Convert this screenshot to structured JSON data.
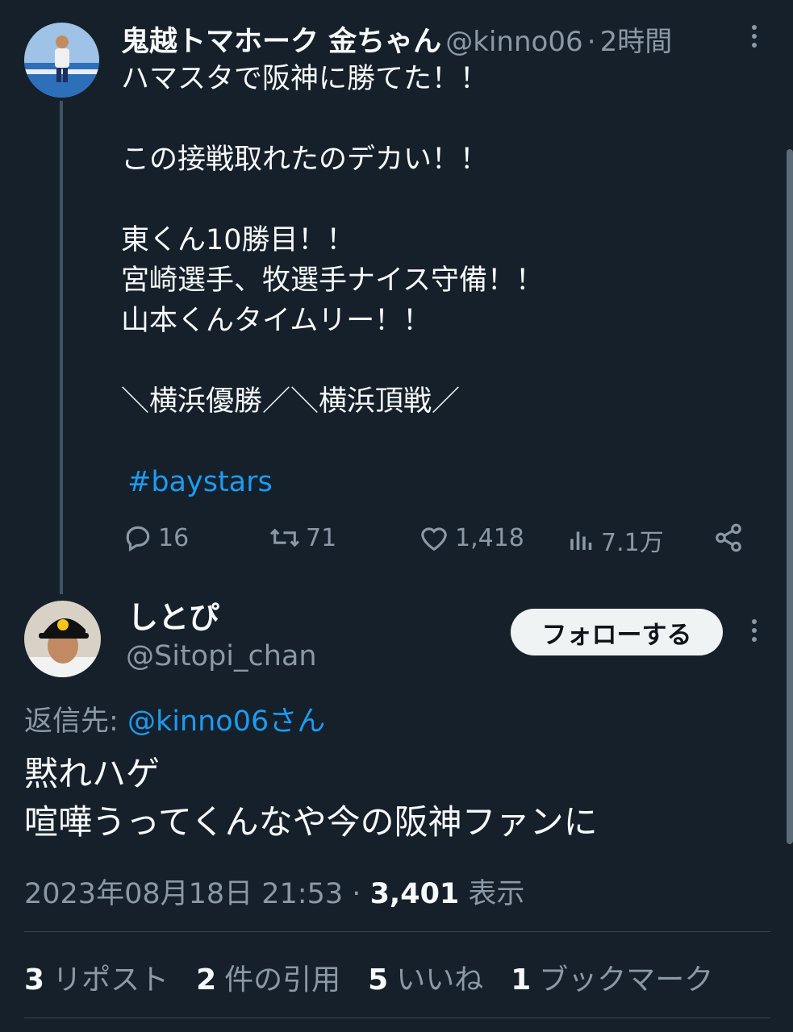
{
  "parent_tweet": {
    "display_name": "鬼越トマホーク 金ちゃん",
    "handle": "@kinno06",
    "separator": "·",
    "time_ago": "2時間",
    "lines": [
      "ハマスタで阪神に勝てた！！",
      "",
      "この接戦取れたのデカい！！",
      "",
      "東くん10勝目！！",
      "宮崎選手、牧選手ナイス守備！！",
      "山本くんタイムリー！！",
      "",
      "＼横浜優勝／＼横浜頂戦／",
      ""
    ],
    "hashtag": "#baystars",
    "actions": {
      "replies": "16",
      "reposts": "71",
      "likes": "1,418",
      "views": "7.1万"
    }
  },
  "reply_tweet": {
    "display_name": "しとぴ",
    "handle": "@Sitopi_chan",
    "follow_label": "フォローする",
    "reply_to_prefix": "返信先:",
    "reply_to_handle": "@kinno06さん",
    "lines": [
      "黙れハゲ",
      "喧嘩うってくんなや今の阪神ファンに"
    ],
    "timestamp": "2023年08月18日 21:53",
    "separator": "·",
    "views_count": "3,401",
    "views_label": "表示"
  },
  "stats": [
    {
      "count": "3",
      "label": "リポスト"
    },
    {
      "count": "2",
      "label": "件の引用"
    },
    {
      "count": "5",
      "label": "いいね"
    },
    {
      "count": "1",
      "label": "ブックマーク"
    }
  ],
  "colors": {
    "background": "#15202b",
    "accent": "#1d9bf0",
    "muted": "#8b98a5"
  }
}
